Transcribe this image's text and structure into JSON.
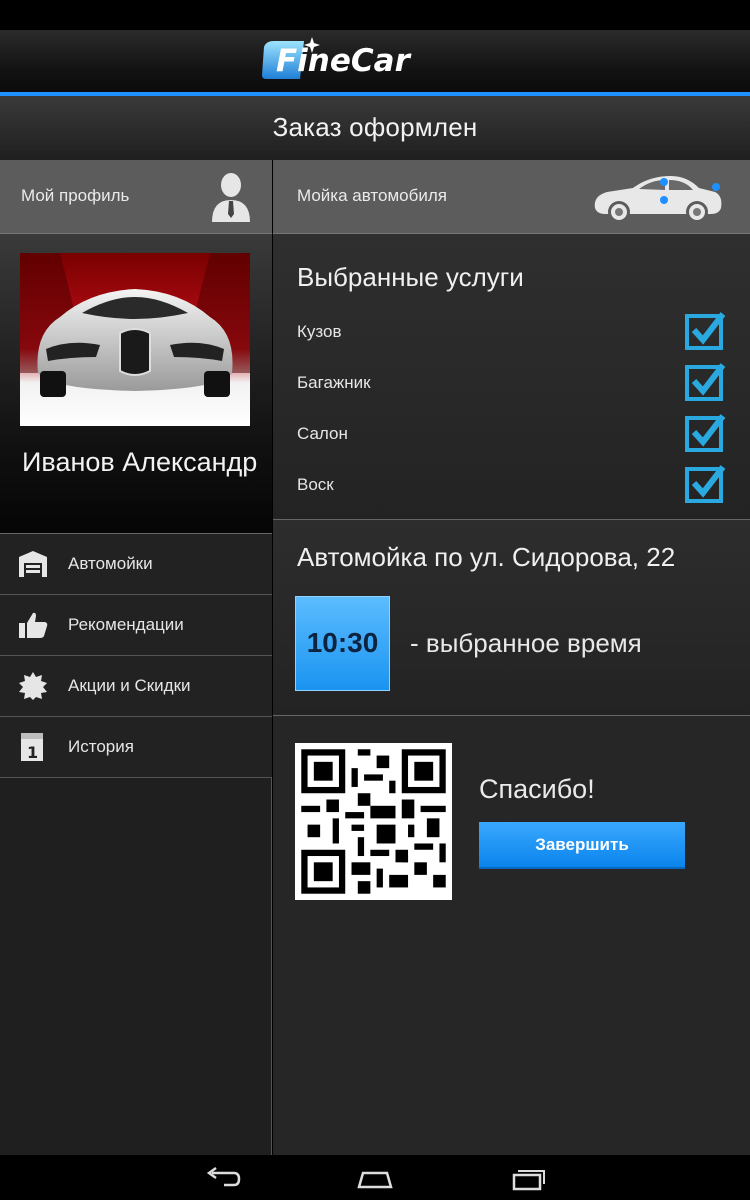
{
  "app": {
    "logo_text": "FineCar",
    "accent_color": "#1e90ff",
    "title": "Заказ оформлен"
  },
  "sidebar": {
    "profile_label": "Мой профиль",
    "profile_icon": "user-avatar-icon",
    "user_name": "Иванов Александр",
    "items": [
      {
        "label": "Автомойки",
        "icon": "garage-icon"
      },
      {
        "label": "Рекомендации",
        "icon": "thumbs-up-icon"
      },
      {
        "label": "Акции и Скидки",
        "icon": "starburst-icon"
      },
      {
        "label": "История",
        "icon": "calendar-icon"
      }
    ]
  },
  "main": {
    "service_label": "Мойка автомобиля",
    "service_icon": "car-side-icon",
    "services_title": "Выбранные услуги",
    "services": [
      {
        "label": "Кузов",
        "checked": true
      },
      {
        "label": "Багажник",
        "checked": true
      },
      {
        "label": "Салон",
        "checked": true
      },
      {
        "label": "Воск",
        "checked": true
      }
    ],
    "wash_address": "Автомойка по ул. Сидорова, 22",
    "selected_time": "10:30",
    "time_caption": "- выбранное время",
    "thanks": "Спасибо!",
    "finish_button": "Завершить"
  },
  "system_nav": {
    "buttons": [
      "back-icon",
      "home-icon",
      "recent-apps-icon"
    ]
  }
}
